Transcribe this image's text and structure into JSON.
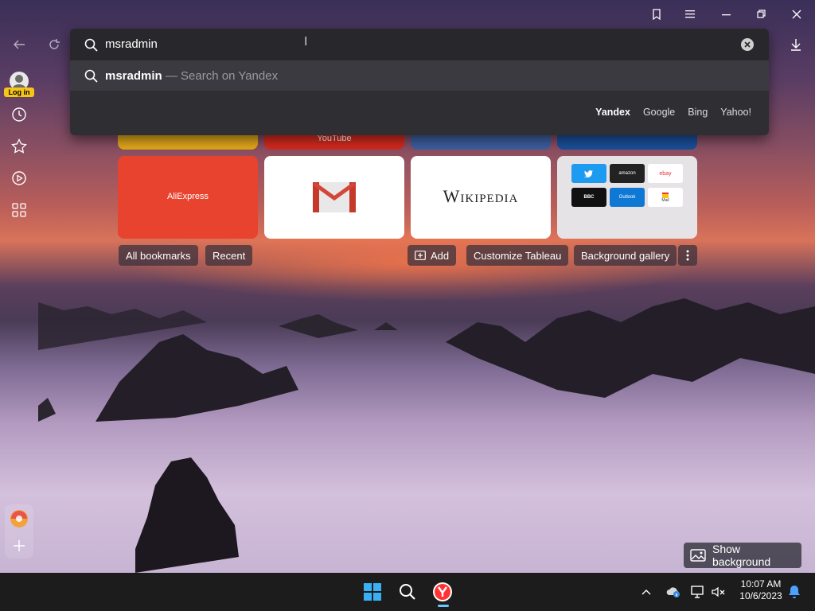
{
  "omnibox": {
    "query": "msradmin",
    "suggestion_bold": "msradmin",
    "suggestion_rest": " — Search on Yandex",
    "engines": [
      "Yandex",
      "Google",
      "Bing",
      "Yahoo!"
    ]
  },
  "sidebar": {
    "login_label": "Log in"
  },
  "tiles": {
    "top_row_partial": [
      "YouTube"
    ],
    "aliexpress": "AliExpress",
    "wikipedia": "Wikipedia",
    "mini_tiles": [
      "twitter",
      "amazon",
      "ebay",
      "BBC",
      "Outlook",
      "Mail"
    ]
  },
  "toolbar": {
    "all_bookmarks": "All bookmarks",
    "recent": "Recent",
    "add": "Add",
    "customize": "Customize Tableau",
    "gallery": "Background gallery"
  },
  "show_background": "Show background",
  "clock": {
    "time": "10:07 AM",
    "date": "10/6/2023"
  },
  "colors": {
    "aliexpress": "#e8432f",
    "wiki_bg": "#ffffff",
    "yandex_red": "#f33",
    "notif": "#4aa3ff"
  }
}
